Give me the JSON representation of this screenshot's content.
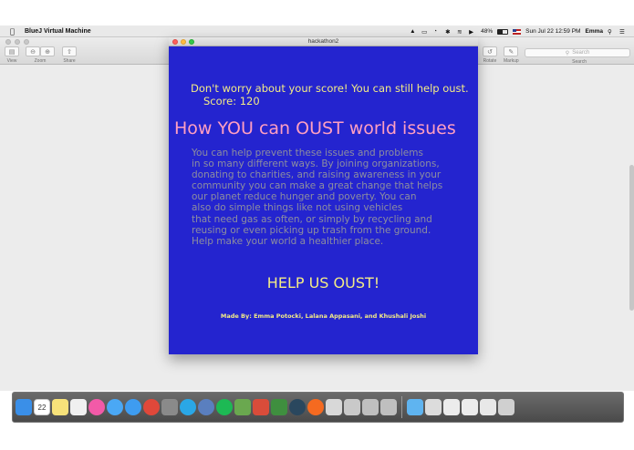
{
  "menubar": {
    "app_name": "BlueJ Virtual Machine",
    "battery": "48%",
    "date_time": "Sun Jul 22  12:59 PM",
    "user": "Emma"
  },
  "preview_toolbar": {
    "view_label": "View",
    "zoom_label": "Zoom",
    "share_label": "Share",
    "rotate_label": "Rotate",
    "markup_label": "Markup",
    "search_placeholder": "Search",
    "search_label": "Search"
  },
  "app_window": {
    "title": "hackathon2",
    "worry_text": "Don't worry about your score! You can still help oust.",
    "score_text": "Score: 120",
    "headline": "How YOU can OUST world issues",
    "paragraph_lines": [
      "You can help prevent these issues and problems",
      "in so many different ways. By joining organizations,",
      "donating to charities, and raising awareness in your",
      "community you can make a great change that helps",
      "our planet reduce hunger and poverty. You can",
      "also do simple things like not using vehicles",
      "that need gas as often, or simply by recycling and",
      "reusing or even picking up trash from the ground.",
      "Help make your world a healthier place."
    ],
    "cta": "HELP US OUST!",
    "credits": "Made By: Emma Potocki, Lalana Appasani, and Khushali Joshi"
  },
  "dock": {
    "calendar_day": "22",
    "icons": [
      {
        "name": "finder-icon",
        "color": "#3a8fe8"
      },
      {
        "name": "calendar-icon",
        "color": "#ffffff"
      },
      {
        "name": "notes-icon",
        "color": "#f7e27a"
      },
      {
        "name": "document-icon",
        "color": "#f0f0f0"
      },
      {
        "name": "itunes-icon",
        "color": "#f25aa8"
      },
      {
        "name": "messages-icon",
        "color": "#4aa8f5"
      },
      {
        "name": "safari-icon",
        "color": "#3e9cf0"
      },
      {
        "name": "chrome-icon",
        "color": "#e0483a"
      },
      {
        "name": "system-preferences-icon",
        "color": "#8a8a8a"
      },
      {
        "name": "skype-icon",
        "color": "#2aa7e6"
      },
      {
        "name": "quicktime-icon",
        "color": "#5a7fbf"
      },
      {
        "name": "spotify-icon",
        "color": "#1db954"
      },
      {
        "name": "minecraft-icon",
        "color": "#6aa84f"
      },
      {
        "name": "sketchup-icon",
        "color": "#d94c3a"
      },
      {
        "name": "java-icon",
        "color": "#3f8f3f"
      },
      {
        "name": "steam-icon",
        "color": "#2a475e"
      },
      {
        "name": "origin-icon",
        "color": "#f56a20"
      },
      {
        "name": "bluej-icon",
        "color": "#d8d8d8"
      },
      {
        "name": "preview-icon",
        "color": "#c9c9c9"
      },
      {
        "name": "app-window-icon",
        "color": "#bfbfbf"
      },
      {
        "name": "app-window2-icon",
        "color": "#bfbfbf"
      }
    ],
    "right_icons": [
      {
        "name": "folder-icon",
        "color": "#5fb4f0"
      },
      {
        "name": "screenshot-icon",
        "color": "#dcdcdc"
      },
      {
        "name": "document-stack-icon",
        "color": "#ececec"
      },
      {
        "name": "document-stack2-icon",
        "color": "#ececec"
      },
      {
        "name": "mail-icon",
        "color": "#e8e8e8"
      },
      {
        "name": "trash-icon",
        "color": "#d0d0d0"
      }
    ]
  }
}
